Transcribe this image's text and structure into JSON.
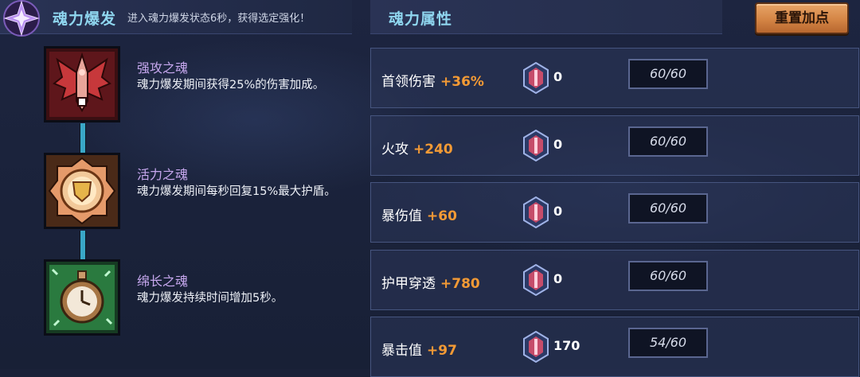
{
  "burst": {
    "title": "魂力爆发",
    "description": "进入魂力爆发状态6秒，获得选定强化！"
  },
  "souls": [
    {
      "name": "强攻之魂",
      "description": "魂力爆发期间获得25%的伤害加成。",
      "icon": "red-wing-soul-icon"
    },
    {
      "name": "活力之魂",
      "description": "魂力爆发期间每秒回复15%最大护盾。",
      "icon": "shield-soul-icon"
    },
    {
      "name": "绵长之魂",
      "description": "魂力爆发持续时间增加5秒。",
      "icon": "stopwatch-soul-icon"
    }
  ],
  "attributes": {
    "title": "魂力属性",
    "reset_label": "重置加点",
    "rows": [
      {
        "name": "首领伤害",
        "bonus": "+36%",
        "crystals": "0",
        "level": "60/60"
      },
      {
        "name": "火攻",
        "bonus": "+240",
        "crystals": "0",
        "level": "60/60"
      },
      {
        "name": "暴伤值",
        "bonus": "+60",
        "crystals": "0",
        "level": "60/60"
      },
      {
        "name": "护甲穿透",
        "bonus": "+780",
        "crystals": "0",
        "level": "60/60"
      },
      {
        "name": "暴击值",
        "bonus": "+97",
        "crystals": "170",
        "level": "54/60"
      }
    ]
  },
  "colors": {
    "title_cyan": "#8fd6ef",
    "soul_name_purple": "#c7a8ef",
    "bonus_orange": "#f39a35",
    "button_orange": "#d48545"
  }
}
